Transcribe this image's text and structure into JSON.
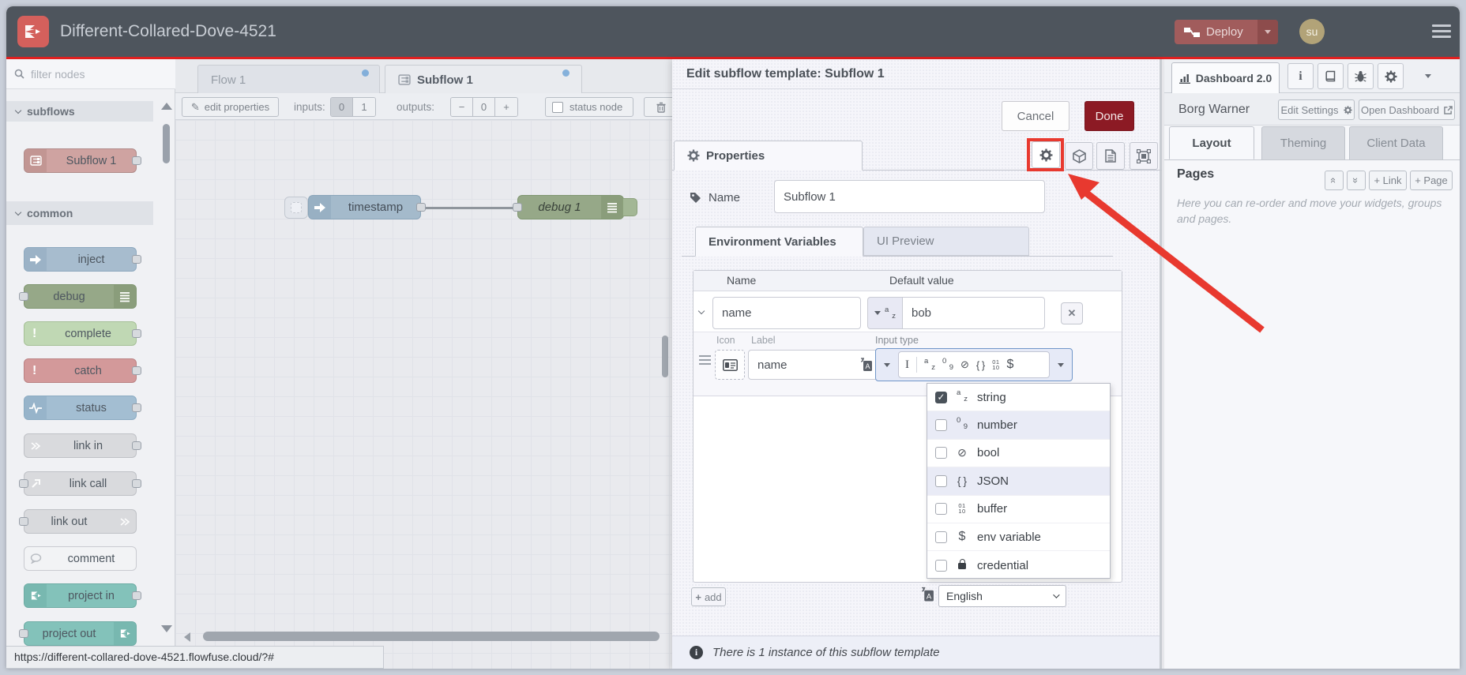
{
  "colors": {
    "header_bg": "#4e555d",
    "accent_red_line": "#e02020",
    "deploy_bg": "#a15c5c",
    "done_bg": "#8c1a24",
    "annotation_red": "#e8392f",
    "focus_blue": "#7096c9",
    "flowfuse_logo": "#d4605c",
    "project_node_teal": "#83c2ba",
    "modified_dot_blue": "#6ba3d6"
  },
  "header": {
    "title": "Different-Collared-Dove-4521",
    "deploy_label": "Deploy",
    "avatar_initials": "su"
  },
  "palette": {
    "search_placeholder": "filter nodes",
    "sections": [
      {
        "label": "subflows",
        "nodes": [
          {
            "label": "Subflow 1"
          }
        ]
      },
      {
        "label": "common",
        "nodes": [
          {
            "label": "inject"
          },
          {
            "label": "debug"
          },
          {
            "label": "complete"
          },
          {
            "label": "catch"
          },
          {
            "label": "status"
          },
          {
            "label": "link in"
          },
          {
            "label": "link call"
          },
          {
            "label": "link out"
          },
          {
            "label": "comment"
          },
          {
            "label": "project in"
          },
          {
            "label": "project out"
          }
        ]
      }
    ]
  },
  "workspace": {
    "tabs": [
      {
        "label": "Flow 1"
      },
      {
        "label": "Subflow 1"
      }
    ],
    "toolbar": {
      "edit_properties": "edit properties",
      "inputs_label": "inputs:",
      "input_zero": "0",
      "input_one": "1",
      "outputs_label": "outputs:",
      "minus": "−",
      "outputs_value": "0",
      "plus": "+",
      "status_node_label": "status node"
    },
    "nodes": {
      "inject_label": "timestamp",
      "debug_label": "debug 1"
    }
  },
  "dialog": {
    "title": "Edit subflow template: Subflow 1",
    "cancel_label": "Cancel",
    "done_label": "Done",
    "properties_tab": "Properties",
    "name_label": "Name",
    "name_value": "Subflow 1",
    "env_tab": "Environment Variables",
    "ui_tab": "UI Preview",
    "table": {
      "name_col": "Name",
      "default_col": "Default value",
      "row": {
        "name": "name",
        "value": "bob"
      }
    },
    "detail": {
      "icon_label": "Icon",
      "label_label": "Label",
      "label_value": "name",
      "input_type_label": "Input type"
    },
    "type_options": [
      {
        "label": "string",
        "checked": true
      },
      {
        "label": "number",
        "checked": false
      },
      {
        "label": "bool",
        "checked": false
      },
      {
        "label": "JSON",
        "checked": false
      },
      {
        "label": "buffer",
        "checked": false
      },
      {
        "label": "env variable",
        "checked": false
      },
      {
        "label": "credential",
        "checked": false
      }
    ],
    "add_label": "add",
    "language_value": "English",
    "footer_note": "There is 1 instance of this subflow template"
  },
  "sidebar": {
    "dashboard_tab": "Dashboard 2.0",
    "client_name": "Borg Warner",
    "edit_settings_label": "Edit Settings",
    "open_dashboard_label": "Open Dashboard",
    "tabs": [
      {
        "label": "Layout"
      },
      {
        "label": "Theming"
      },
      {
        "label": "Client Data"
      }
    ],
    "pages_heading": "Pages",
    "link_button": "+ Link",
    "page_button": "+ Page",
    "help_text": "Here you can re-order and move your widgets, groups and pages."
  },
  "statusbar": {
    "url": "https://different-collared-dove-4521.flowfuse.cloud/?#"
  }
}
